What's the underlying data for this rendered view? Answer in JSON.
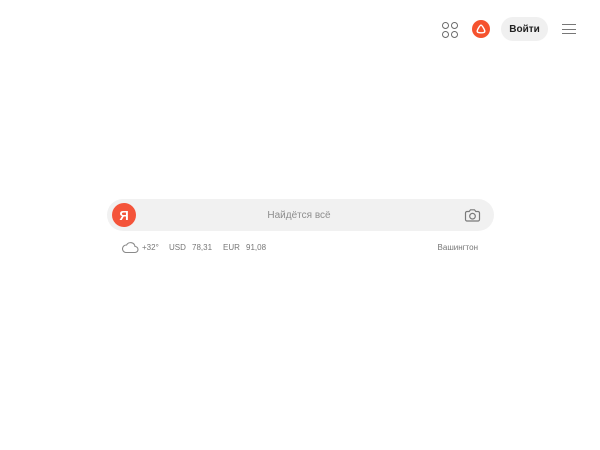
{
  "header": {
    "apps_icon": "apps-grid-icon",
    "alice_icon": "alice-assistant-icon",
    "login_label": "Войти",
    "menu_icon": "hamburger-menu-icon",
    "accent_color": "#f5522e"
  },
  "search": {
    "logo_text": "Я",
    "placeholder": "Найдётся всё",
    "value": "",
    "camera_icon": "camera-search-icon"
  },
  "info": {
    "weather_icon": "cloud-icon",
    "temperature": "+32°",
    "currencies": [
      {
        "code": "USD",
        "value": "78,31"
      },
      {
        "code": "EUR",
        "value": "91,08"
      }
    ],
    "city": "Вашингтон"
  }
}
